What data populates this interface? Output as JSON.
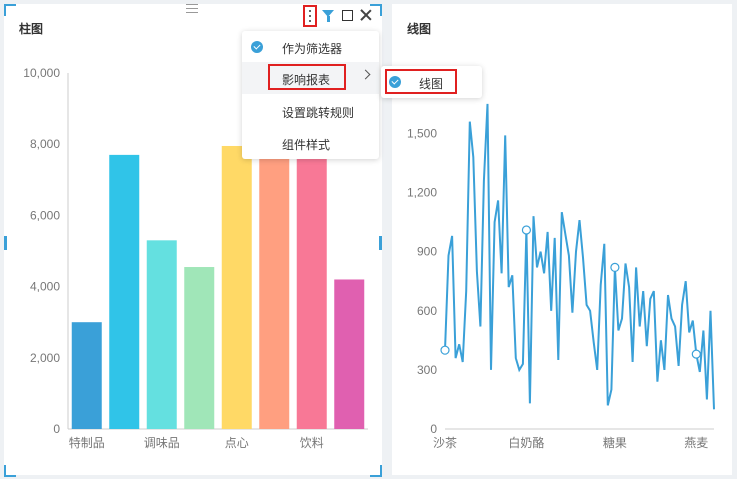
{
  "left_panel": {
    "title": "柱图"
  },
  "right_panel": {
    "title": "线图"
  },
  "context_menu": {
    "items": [
      {
        "label": "作为筛选器",
        "checked": true
      },
      {
        "label": "影响报表",
        "has_submenu": true
      },
      {
        "label": "设置跳转规则"
      },
      {
        "label": "组件样式"
      }
    ],
    "submenu": [
      {
        "label": "线图",
        "checked": true
      }
    ]
  },
  "colors": {
    "accent": "#3aa0d8",
    "highlight": "#e02020"
  },
  "icons": [
    "more-vertical-icon",
    "filter-icon",
    "maximize-icon",
    "close-icon",
    "drag-handle-icon",
    "check-circle-icon",
    "chevron-right-icon"
  ],
  "chart_data": [
    {
      "type": "bar",
      "categories": [
        "特制品",
        "",
        "调味品",
        "",
        "点心",
        "",
        "饮料",
        ""
      ],
      "values": [
        3000,
        7700,
        5300,
        4550,
        7950,
        7800,
        8150,
        4200
      ],
      "colors": [
        "#3aa0d8",
        "#30c4e8",
        "#64e0e0",
        "#a0e6b8",
        "#ffd966",
        "#ff9f80",
        "#f87896",
        "#e060b0"
      ],
      "yticks": [
        "0",
        "2,000",
        "4,000",
        "6,000",
        "8,000",
        "10,000"
      ],
      "ylim": [
        0,
        10000
      ]
    },
    {
      "type": "line",
      "xticks": [
        "沙茶",
        "白奶酪",
        "糖果",
        "燕麦"
      ],
      "yticks": [
        "0",
        "300",
        "600",
        "900",
        "1,200",
        "1,500"
      ],
      "ylim": [
        0,
        1700
      ],
      "color": "#3aa0d8",
      "values": [
        400,
        880,
        980,
        360,
        430,
        340,
        700,
        1560,
        1380,
        800,
        520,
        1260,
        1650,
        300,
        1050,
        1160,
        790,
        1490,
        720,
        780,
        360,
        300,
        330,
        1010,
        130,
        1080,
        820,
        900,
        790,
        1000,
        600,
        970,
        350,
        1100,
        990,
        880,
        590,
        900,
        1060,
        870,
        630,
        600,
        440,
        300,
        730,
        940,
        120,
        200,
        820,
        500,
        560,
        840,
        720,
        340,
        820,
        520,
        700,
        420,
        660,
        700,
        240,
        450,
        300,
        680,
        560,
        520,
        320,
        630,
        750,
        490,
        550,
        380,
        290,
        500,
        150,
        600,
        100
      ],
      "markers": [
        0,
        23,
        48,
        71
      ]
    }
  ]
}
